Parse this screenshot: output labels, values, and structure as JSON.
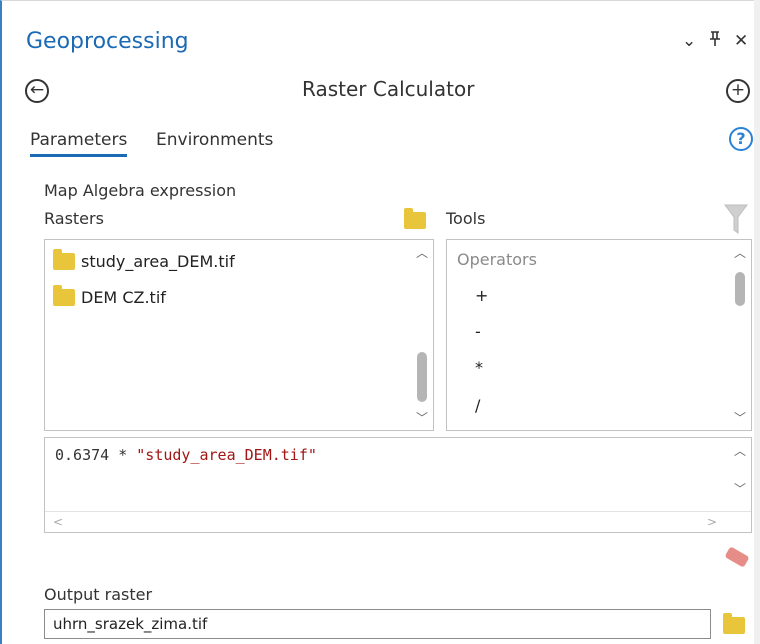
{
  "pane": {
    "title": "Geoprocessing",
    "controls": {
      "dropdown": "⌄",
      "pin": "ᵖ",
      "close": "✕"
    },
    "back_icon": "←",
    "add_icon": "+",
    "tool_title": "Raster Calculator"
  },
  "tabs": [
    {
      "label": "Parameters",
      "active": true
    },
    {
      "label": "Environments",
      "active": false
    }
  ],
  "help_icon": "?",
  "map_algebra": {
    "label": "Map Algebra expression",
    "rasters_label": "Rasters",
    "tools_label": "Tools",
    "rasters": [
      "study_area_DEM.tif",
      "DEM CZ.tif"
    ],
    "tools_header": "Operators",
    "operators": [
      "+",
      "-",
      "*",
      "/"
    ],
    "expression_number": "0.6374 * ",
    "expression_string": "\"study_area_DEM.tif\""
  },
  "output": {
    "label": "Output raster",
    "value": "uhrn_srazek_zima.tif"
  },
  "colors": {
    "accent": "#1b6ab3",
    "folder": "#e8c53a",
    "string_literal": "#a31515",
    "eraser": "#e58d86"
  }
}
